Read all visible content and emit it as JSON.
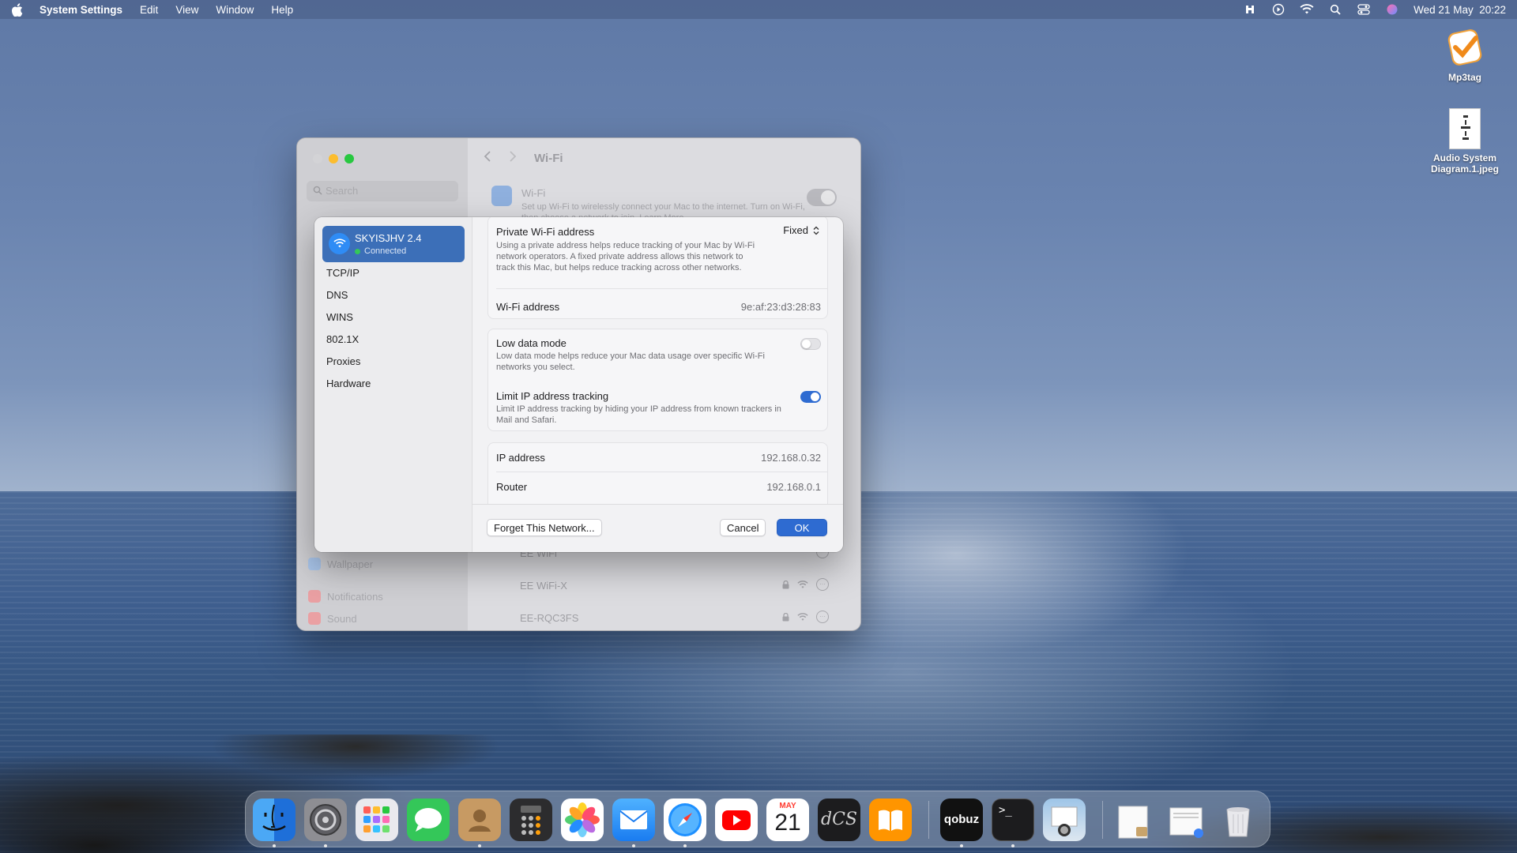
{
  "menubar": {
    "app_name": "System Settings",
    "menus": [
      "Edit",
      "View",
      "Window",
      "Help"
    ],
    "datetime": "Wed 21 May  20:22"
  },
  "desktop": {
    "icons": [
      {
        "label": "Mp3tag"
      },
      {
        "label": "Audio System Diagram.1.jpeg"
      }
    ]
  },
  "settings_window": {
    "search_placeholder": "Search",
    "title": "Wi-Fi",
    "wifi_row": {
      "title": "Wi-Fi",
      "description": "Set up Wi-Fi to wirelessly connect your Mac to the internet. Turn on Wi-Fi, then choose a network to join. Learn More..."
    },
    "sidebar_visible": [
      "Wallpaper",
      "Notifications",
      "Sound"
    ],
    "networks": [
      {
        "name": "EE WiFi"
      },
      {
        "name": "EE WiFi-X"
      },
      {
        "name": "EE-RQC3FS"
      }
    ]
  },
  "dialog": {
    "network": {
      "name": "SKYISJHV 2.4",
      "status": "Connected"
    },
    "nav": [
      "TCP/IP",
      "DNS",
      "WINS",
      "802.1X",
      "Proxies",
      "Hardware"
    ],
    "private_address": {
      "title": "Private Wi-Fi address",
      "value": "Fixed",
      "description": "Using a private address helps reduce tracking of your Mac by Wi-Fi network operators. A fixed private address allows this network to track this Mac, but helps reduce tracking across other networks."
    },
    "wifi_address": {
      "label": "Wi-Fi address",
      "value": "9e:af:23:d3:28:83"
    },
    "low_data_mode": {
      "title": "Low data mode",
      "description": "Low data mode helps reduce your Mac data usage over specific Wi-Fi networks you select.",
      "enabled": false
    },
    "limit_ip": {
      "title": "Limit IP address tracking",
      "description": "Limit IP address tracking by hiding your IP address from known trackers in Mail and Safari.",
      "enabled": true
    },
    "ip_address": {
      "label": "IP address",
      "value": "192.168.0.32"
    },
    "router": {
      "label": "Router",
      "value": "192.168.0.1"
    },
    "buttons": {
      "forget": "Forget This Network...",
      "cancel": "Cancel",
      "ok": "OK"
    }
  },
  "dock": {
    "calendar_month": "MAY",
    "calendar_day": "21",
    "dcs_label": "dCS",
    "qobuz_label": "qobuz",
    "terminal_prompt": ">_",
    "apps": [
      "Finder",
      "System Settings",
      "Launchpad",
      "Messages",
      "Contacts",
      "Calculator",
      "Photos",
      "Mail",
      "Safari",
      "YouTube",
      "Calendar",
      "dCS Mosaic",
      "Books",
      "Qobuz",
      "Terminal",
      "Preview",
      "Downloads",
      "Documents",
      "Trash"
    ]
  },
  "colors": {
    "accent": "#2e6bd1",
    "selection": "#3c6fb8",
    "connected_green": "#34c759"
  }
}
